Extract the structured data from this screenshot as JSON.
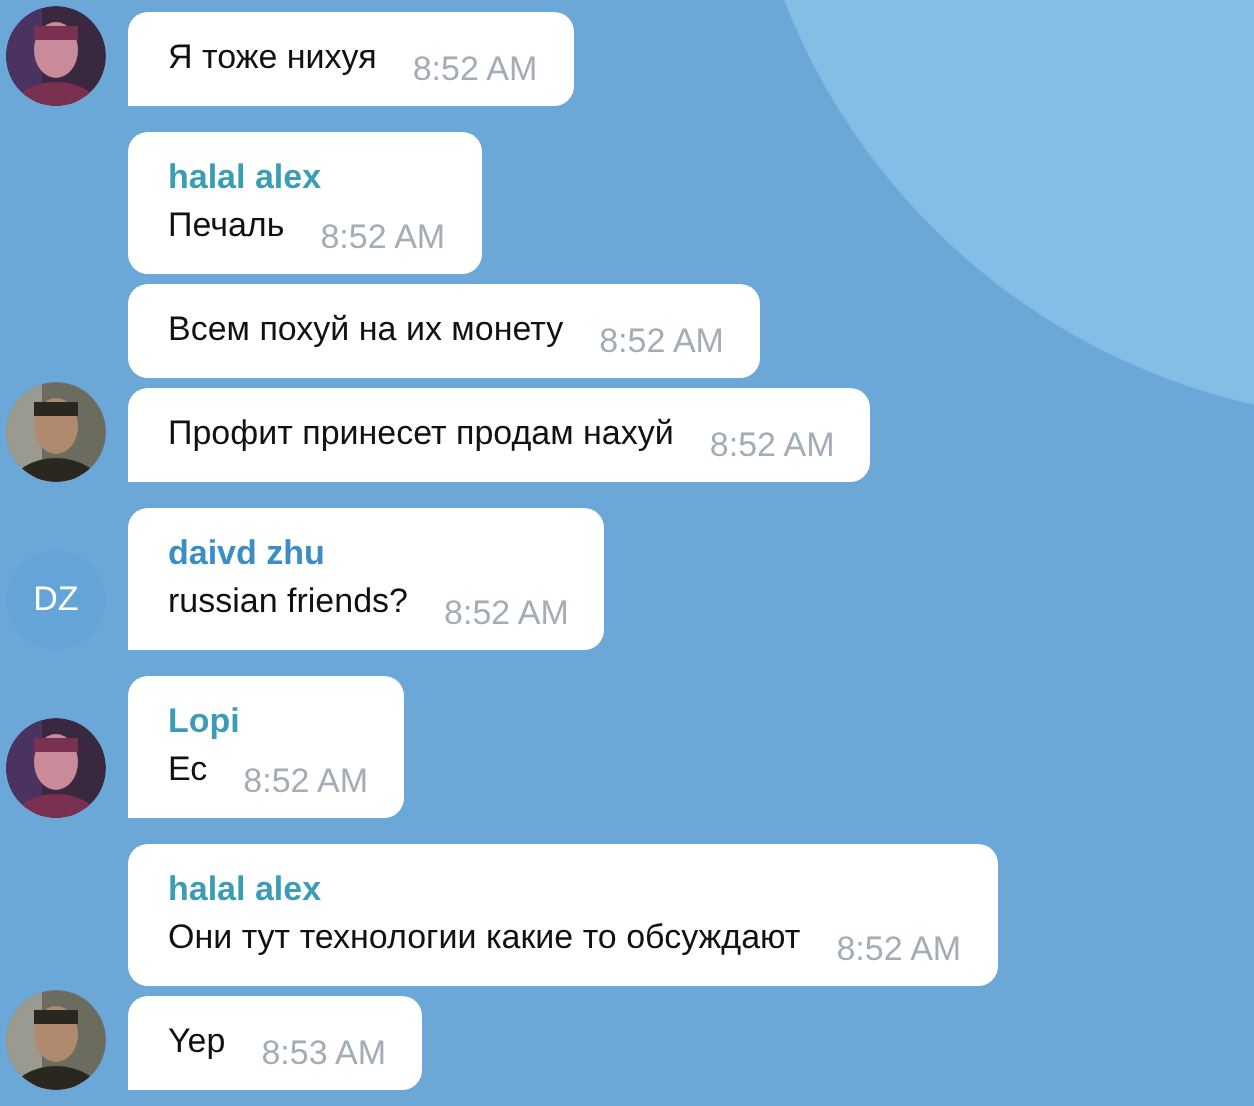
{
  "groups": [
    {
      "avatar": {
        "kind": "picture"
      },
      "messages": [
        {
          "text": "Я тоже нихуя",
          "time": "8:52 AM"
        }
      ]
    },
    {
      "avatar": {
        "kind": "picture"
      },
      "messages": [
        {
          "sender": "halal alex",
          "color": "#3a9db5",
          "text": "Печаль",
          "time": "8:52 AM"
        },
        {
          "text": "Всем похуй на их монету",
          "time": "8:52 AM"
        },
        {
          "text": "Профит принесет продам нахуй",
          "time": "8:52 AM"
        }
      ]
    },
    {
      "avatar": {
        "kind": "initials",
        "initials": "DZ"
      },
      "messages": [
        {
          "sender": "daivd zhu",
          "color": "#3b8dc6",
          "text": "russian friends?",
          "time": "8:52 AM"
        }
      ]
    },
    {
      "avatar": {
        "kind": "picture"
      },
      "messages": [
        {
          "sender": "Lopi",
          "color": "#3a9db5",
          "text": "Ес",
          "time": "8:52 AM"
        }
      ]
    },
    {
      "avatar": {
        "kind": "picture"
      },
      "messages": [
        {
          "sender": "halal alex",
          "color": "#3a9db5",
          "text": "Они тут технологии какие то обсуждают",
          "time": "8:52 AM"
        },
        {
          "text": "Yep",
          "time": "8:53 AM"
        }
      ]
    }
  ]
}
